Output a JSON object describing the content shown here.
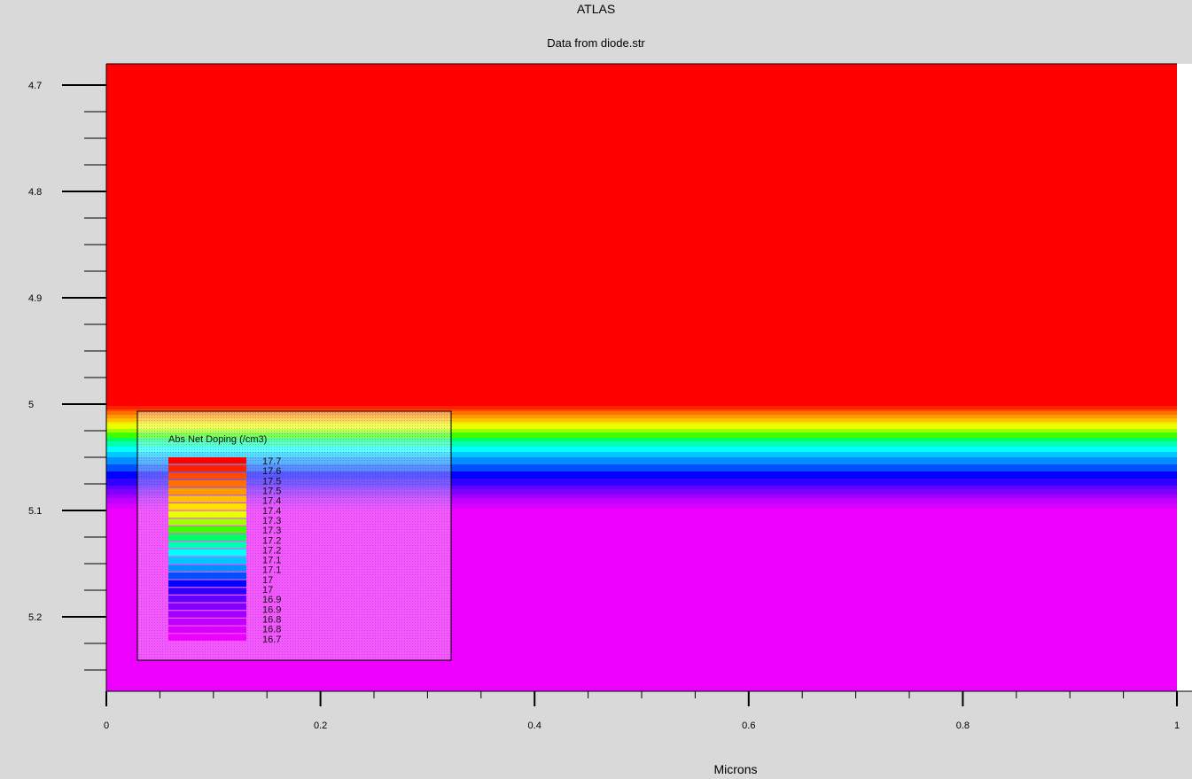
{
  "chart_data": {
    "type": "heatmap",
    "title": "ATLAS",
    "subtitle": "Data from diode.str",
    "xlabel": "Microns",
    "ylabel": "",
    "xlim": [
      0,
      1
    ],
    "ylim": [
      4.68,
      5.27
    ],
    "x_ticks": [
      "0",
      "0.2",
      "0.4",
      "0.6",
      "0.8",
      "1"
    ],
    "y_ticks": [
      "4.7",
      "4.8",
      "4.9",
      "5",
      "5.1",
      "5.2"
    ],
    "field_profile": [
      {
        "y": 4.68,
        "value": 17.7
      },
      {
        "y": 5.0,
        "value": 17.7
      },
      {
        "y": 5.01,
        "value": 17.55
      },
      {
        "y": 5.02,
        "value": 17.4
      },
      {
        "y": 5.03,
        "value": 17.3
      },
      {
        "y": 5.045,
        "value": 17.15
      },
      {
        "y": 5.06,
        "value": 17.05
      },
      {
        "y": 5.075,
        "value": 16.95
      },
      {
        "y": 5.08,
        "value": 16.9
      },
      {
        "y": 5.085,
        "value": 16.85
      },
      {
        "y": 5.1,
        "value": 16.7
      },
      {
        "y": 5.27,
        "value": 16.7
      }
    ],
    "legend": {
      "title": "Abs Net Doping (/cm3)",
      "labels": [
        "17.7",
        "17.6",
        "17.5",
        "17.5",
        "17.4",
        "17.4",
        "17.3",
        "17.3",
        "17.2",
        "17.2",
        "17.1",
        "17.1",
        "17",
        "17",
        "16.9",
        "16.9",
        "16.8",
        "16.8",
        "16.7"
      ],
      "colors": [
        "#ff0000",
        "#ff2000",
        "#ff4a00",
        "#ff7000",
        "#ff9a00",
        "#ffc000",
        "#ffe000",
        "#e8ff00",
        "#a0ff00",
        "#40ff00",
        "#00ff60",
        "#00ffb0",
        "#00ffff",
        "#00c8ff",
        "#0090ff",
        "#0050ff",
        "#0000ff",
        "#3000ff",
        "#6000ff",
        "#8000ff",
        "#a000ff",
        "#c000ff",
        "#d800ff",
        "#ee00ff"
      ]
    }
  }
}
